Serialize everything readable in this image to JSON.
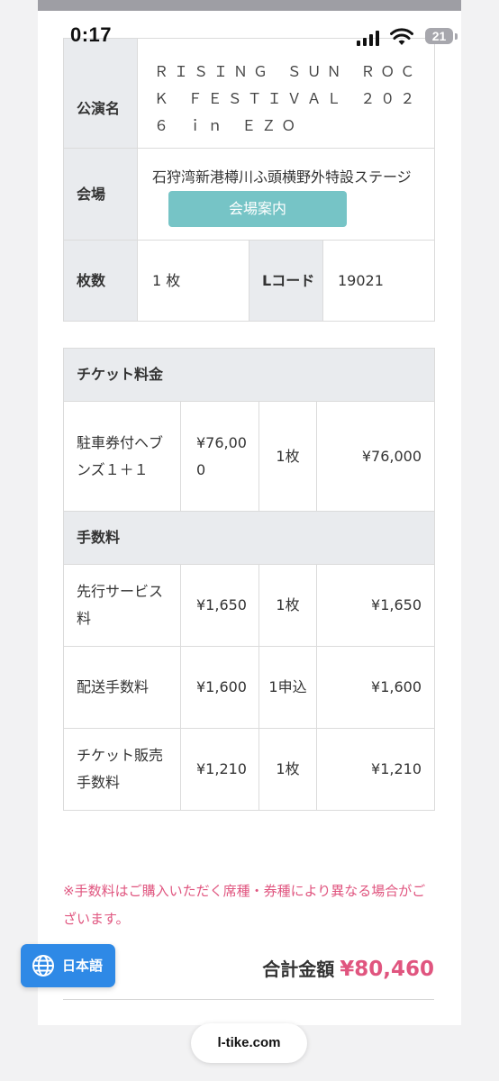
{
  "status_bar": {
    "time": "0:17",
    "battery": "21"
  },
  "info": {
    "event_label": "公演名",
    "event_name": "ＲＩＳＩＮＧ ＳＵＮ ＲＯＣＫ ＦＥＳＴＩＶＡＬ ２０２６ ｉｎ ＥＺＯ",
    "venue_label": "会場",
    "venue_name": "石狩湾新港樽川ふ頭横野外特設ステージ",
    "venue_button": "会場案内",
    "count_label": "枚数",
    "count_value": "1 枚",
    "lcode_label": "Lコード",
    "lcode_value": "19021"
  },
  "ticket_section": {
    "title": "チケット料金",
    "rows": [
      {
        "item": "駐車券付ヘブンズ１＋１",
        "unit": "¥76,000",
        "qty": "1枚",
        "subtotal": "¥76,000"
      }
    ]
  },
  "fee_section": {
    "title": "手数料",
    "rows": [
      {
        "item": "先行サービス料",
        "unit": "¥1,650",
        "qty": "1枚",
        "subtotal": "¥1,650"
      },
      {
        "item": "配送手数料",
        "unit": "¥1,600",
        "qty": "1申込",
        "subtotal": "¥1,600"
      },
      {
        "item": "チケット販売手数料",
        "unit": "¥1,210",
        "qty": "1枚",
        "subtotal": "¥1,210"
      }
    ]
  },
  "notice": "※手数料はご購入いただく席種・券種により異なる場合がございます。",
  "total": {
    "label": "合計金額",
    "value": "¥80,460"
  },
  "language_button": "日本語",
  "url": "l-tike.com",
  "colors": {
    "accent_pink": "#e0557f",
    "venue_button": "#76c4c6",
    "language_button": "#2e89e6",
    "header_cell": "#e9ebee"
  },
  "icons": {
    "signal": "cellular-signal-icon",
    "wifi": "wifi-icon",
    "battery": "battery-icon",
    "language": "globe-icon"
  }
}
